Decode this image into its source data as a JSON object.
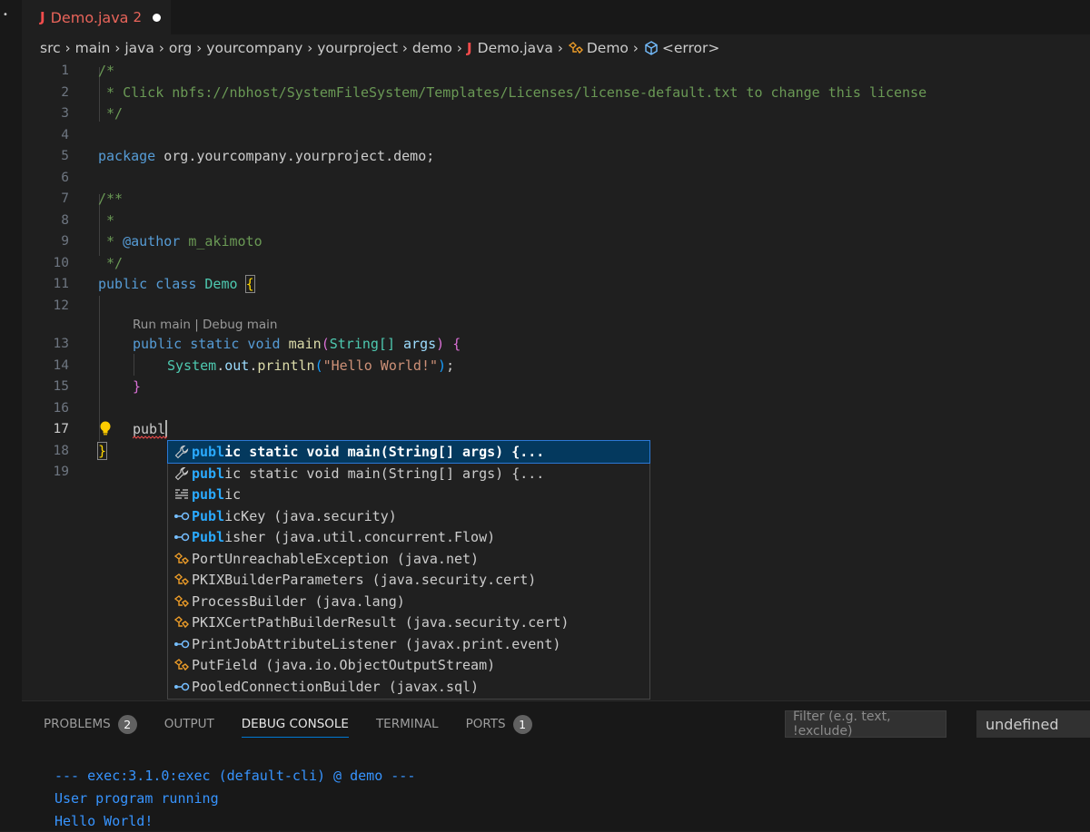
{
  "tab": {
    "icon_letter": "J",
    "name": "Demo.java",
    "problem_count": "2"
  },
  "breadcrumb": [
    "src",
    "main",
    "java",
    "org",
    "yourcompany",
    "yourproject",
    "demo",
    "Demo.java",
    "Demo",
    "<error>"
  ],
  "line_numbers": [
    "1",
    "2",
    "3",
    "4",
    "5",
    "6",
    "7",
    "8",
    "9",
    "10",
    "11",
    "12",
    "13",
    "14",
    "15",
    "16",
    "17",
    "18",
    "19"
  ],
  "code": {
    "l1": "/*",
    "l2": " * Click nbfs://nbhost/SystemFileSystem/Templates/Licenses/license-default.txt to change this license",
    "l3": " */",
    "l5_kw": "package",
    "l5_rest": " org.yourcompany.yourproject.demo;",
    "l7": "/**",
    "l8": " *",
    "l9_star": " * ",
    "l9_tag": "@author",
    "l9_rest": " m_akimoto",
    "l10": " */",
    "l11_kw": "public class",
    "l11_cls": "Demo",
    "l11_brace": "{",
    "codelens": "Run main | Debug main",
    "l13_kw": "public static void",
    "l13_fn": "main",
    "l13_type": "String[]",
    "l13_var": "args",
    "l14_sys": "System",
    "l14_out": "out",
    "l14_fn": "println",
    "l14_str": "\"Hello World!\"",
    "l15": "}",
    "l17": "publ",
    "l18": "}"
  },
  "suggestions": [
    {
      "icon": "wrench-icon",
      "match": "publ",
      "rest": "ic static void main(String[] args) {..."
    },
    {
      "icon": "wrench-icon",
      "match": "publ",
      "rest": "ic static void main(String[] args) {..."
    },
    {
      "icon": "keyword-icon",
      "match": "publ",
      "rest": "ic"
    },
    {
      "icon": "interface-icon",
      "match": "Publ",
      "rest": "icKey (java.security)"
    },
    {
      "icon": "interface-icon",
      "match": "Publ",
      "rest": "isher (java.util.concurrent.Flow)"
    },
    {
      "icon": "class-icon",
      "text": "PortUnreachableException (java.net)"
    },
    {
      "icon": "class-icon",
      "text": "PKIXBuilderParameters (java.security.cert)"
    },
    {
      "icon": "class-icon",
      "text": "ProcessBuilder (java.lang)"
    },
    {
      "icon": "class-icon",
      "text": "PKIXCertPathBuilderResult (java.security.cert)"
    },
    {
      "icon": "interface-icon",
      "text": "PrintJobAttributeListener (javax.print.event)"
    },
    {
      "icon": "class-icon",
      "text": "PutField (java.io.ObjectOutputStream)"
    },
    {
      "icon": "interface-icon",
      "text": "PooledConnectionBuilder (javax.sql)"
    }
  ],
  "panel": {
    "tabs": [
      "PROBLEMS",
      "OUTPUT",
      "DEBUG CONSOLE",
      "TERMINAL",
      "PORTS"
    ],
    "problems_badge": "2",
    "ports_badge": "1",
    "filter_placeholder": "Filter (e.g. text, !exclude)",
    "session": "undefined",
    "console_lines": [
      "--- exec:3.1.0:exec (default-cli) @ demo ---",
      "User program running",
      "Hello World!"
    ]
  },
  "colors": {
    "accent": "#0078d4",
    "error": "#f14c4c",
    "selected": "#04395e"
  }
}
